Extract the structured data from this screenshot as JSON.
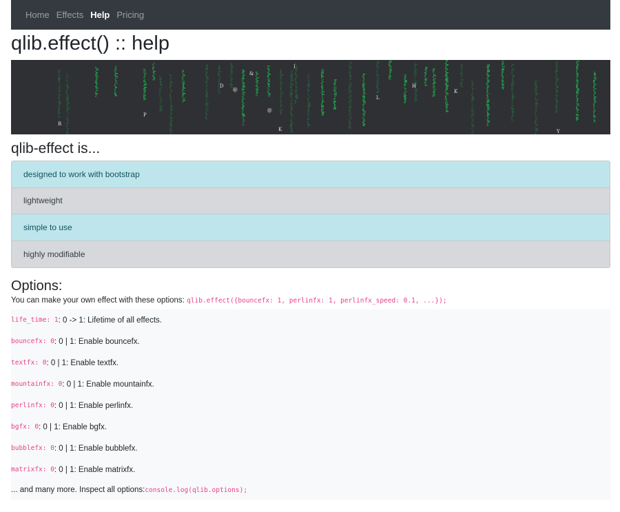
{
  "nav": {
    "items": [
      {
        "label": "Home",
        "active": false
      },
      {
        "label": "Effects",
        "active": false
      },
      {
        "label": "Help",
        "active": true
      },
      {
        "label": "Pricing",
        "active": false
      }
    ]
  },
  "page_title": "qlib.effect() :: help",
  "banner": {
    "glyphs": [
      "R",
      "P",
      "D",
      "@",
      "&",
      "@",
      "K",
      "I",
      "L",
      "H",
      "K",
      "Y"
    ],
    "rain_color": "#1db954",
    "background": "#2f3033"
  },
  "features": {
    "title": "qlib-effect is...",
    "items": [
      {
        "label": "designed to work with bootstrap",
        "style": "info"
      },
      {
        "label": "lightweight",
        "style": "secondary"
      },
      {
        "label": "simple to use",
        "style": "info"
      },
      {
        "label": "highly modifiable",
        "style": "secondary"
      }
    ]
  },
  "options": {
    "title": "Options:",
    "intro_text": "You can make your own effect with these options: ",
    "intro_code": "qlib.effect({bouncefx: 1, perlinfx: 1, perlinfx_speed: 0.1, ...});",
    "rows": [
      {
        "code": "life_time: 1",
        "desc": ": 0 -> 1: Lifetime of all effects."
      },
      {
        "code": "bouncefx: 0",
        "desc": ": 0 | 1: Enable bouncefx."
      },
      {
        "code": "textfx: 0",
        "desc": ": 0 | 1: Enable textfx."
      },
      {
        "code": "mountainfx: 0",
        "desc": ": 0 | 1: Enable mountainfx."
      },
      {
        "code": "perlinfx: 0",
        "desc": ": 0 | 1: Enable perlinfx."
      },
      {
        "code": "bgfx: 0",
        "desc": ": 0 | 1: Enable bgfx."
      },
      {
        "code": "bubblefx: 0",
        "desc": ": 0 | 1: Enable bubblefx."
      },
      {
        "code": "matrixfx: 0",
        "desc": ": 0 | 1: Enable matrixfx."
      }
    ],
    "footer_text": "... and many more. Inspect all options: ",
    "footer_code": "console.log(qlib.options);"
  }
}
